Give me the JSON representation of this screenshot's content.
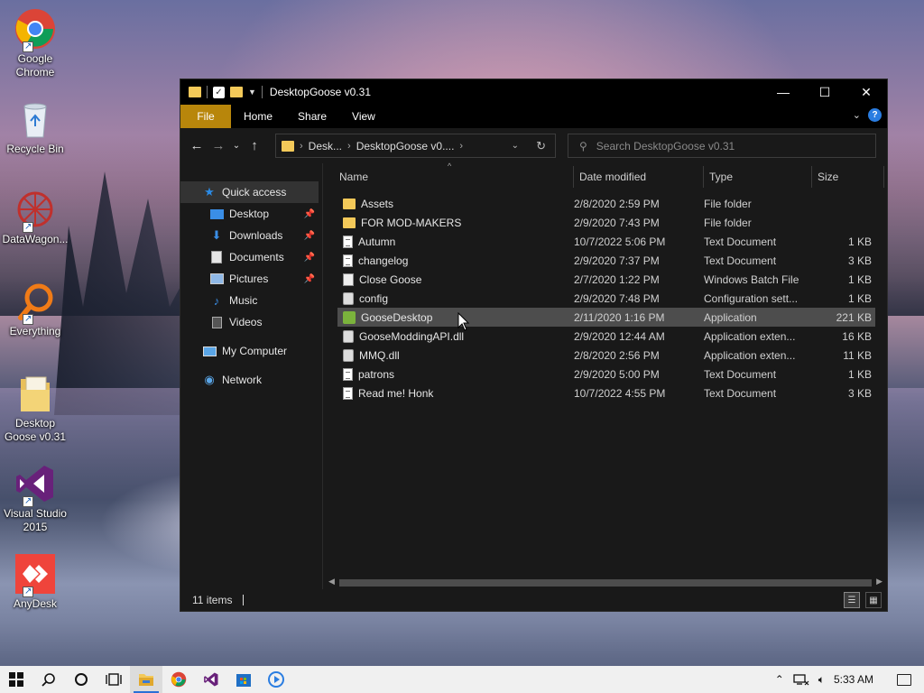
{
  "desktop": {
    "icons": [
      {
        "label": "Google Chrome",
        "icon": "chrome-icon"
      },
      {
        "label": "Recycle Bin",
        "icon": "recycle-bin-icon"
      },
      {
        "label": "DataWagon...",
        "icon": "datawagon-icon"
      },
      {
        "label": "Everything",
        "icon": "everything-search-icon"
      },
      {
        "label": "Desktop Goose v0.31",
        "icon": "folder-icon"
      },
      {
        "label": "Visual Studio 2015",
        "icon": "visual-studio-icon"
      },
      {
        "label": "AnyDesk",
        "icon": "anydesk-icon"
      }
    ]
  },
  "window": {
    "title": "DesktopGoose v0.31",
    "controls": {
      "minimize": "—",
      "maximize": "☐",
      "close": "✕"
    },
    "ribbon_tabs": [
      "File",
      "Home",
      "Share",
      "View"
    ],
    "address": {
      "segments": [
        "Desk...",
        "DesktopGoose v0...."
      ]
    },
    "search_placeholder": "Search DesktopGoose v0.31",
    "nav_pane": {
      "quick_access": "Quick access",
      "quick_items": [
        {
          "label": "Desktop",
          "icon": "desktop-icon",
          "pinned": true
        },
        {
          "label": "Downloads",
          "icon": "downloads-icon",
          "pinned": true
        },
        {
          "label": "Documents",
          "icon": "documents-icon",
          "pinned": true
        },
        {
          "label": "Pictures",
          "icon": "pictures-icon",
          "pinned": true
        },
        {
          "label": "Music",
          "icon": "music-icon",
          "pinned": false
        },
        {
          "label": "Videos",
          "icon": "videos-icon",
          "pinned": false
        }
      ],
      "my_computer": "My Computer",
      "network": "Network"
    },
    "columns": {
      "name": "Name",
      "date": "Date modified",
      "type": "Type",
      "size": "Size"
    },
    "files": [
      {
        "name": "Assets",
        "date": "2/8/2020 2:59 PM",
        "type": "File folder",
        "size": "",
        "icon": "folder"
      },
      {
        "name": "FOR MOD-MAKERS",
        "date": "2/9/2020 7:43 PM",
        "type": "File folder",
        "size": "",
        "icon": "folder"
      },
      {
        "name": "Autumn",
        "date": "10/7/2022 5:06 PM",
        "type": "Text Document",
        "size": "1 KB",
        "icon": "doc"
      },
      {
        "name": "changelog",
        "date": "2/9/2020 7:37 PM",
        "type": "Text Document",
        "size": "3 KB",
        "icon": "doc"
      },
      {
        "name": "Close Goose",
        "date": "2/7/2020 1:22 PM",
        "type": "Windows Batch File",
        "size": "1 KB",
        "icon": "bat"
      },
      {
        "name": "config",
        "date": "2/9/2020 7:48 PM",
        "type": "Configuration sett...",
        "size": "1 KB",
        "icon": "gear"
      },
      {
        "name": "GooseDesktop",
        "date": "2/11/2020 1:16 PM",
        "type": "Application",
        "size": "221 KB",
        "icon": "app"
      },
      {
        "name": "GooseModdingAPI.dll",
        "date": "2/9/2020 12:44 AM",
        "type": "Application exten...",
        "size": "16 KB",
        "icon": "gear"
      },
      {
        "name": "MMQ.dll",
        "date": "2/8/2020 2:56 PM",
        "type": "Application exten...",
        "size": "11 KB",
        "icon": "gear"
      },
      {
        "name": "patrons",
        "date": "2/9/2020 5:00 PM",
        "type": "Text Document",
        "size": "1 KB",
        "icon": "doc"
      },
      {
        "name": "Read me! Honk",
        "date": "10/7/2022 4:55 PM",
        "type": "Text Document",
        "size": "3 KB",
        "icon": "doc"
      }
    ],
    "status": "11 items"
  },
  "taskbar": {
    "time": "5:33 AM"
  }
}
